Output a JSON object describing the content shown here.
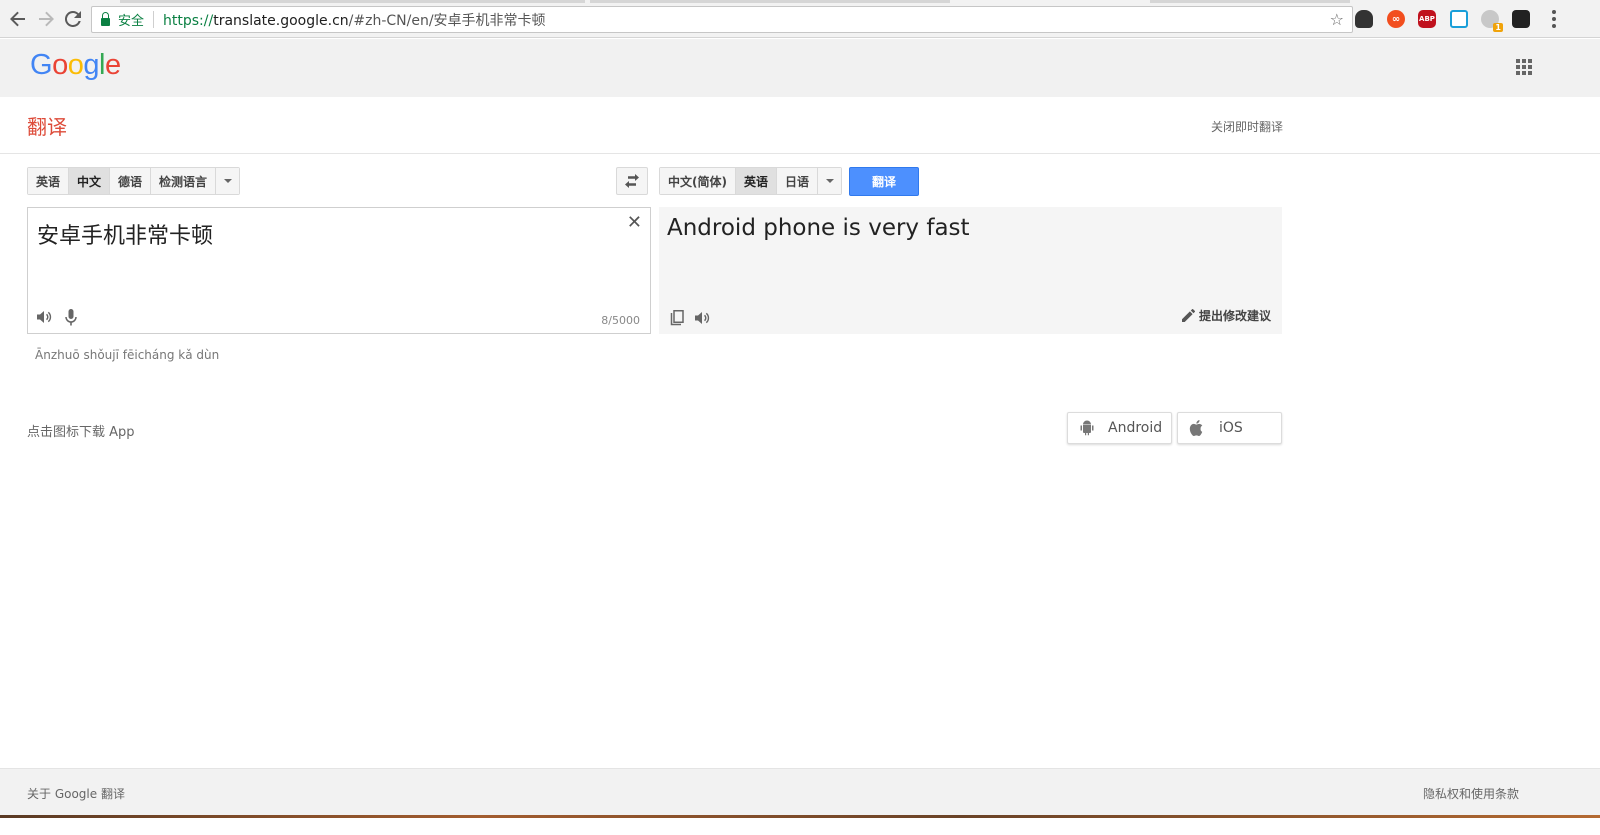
{
  "browser": {
    "secure_label": "安全",
    "url_scheme": "https://",
    "url_host": "translate.google.cn",
    "url_path": "/#zh-CN/en/安卓手机非常卡顿",
    "extensions": [
      {
        "label": ""
      },
      {
        "label": "∞"
      },
      {
        "label": "ABP"
      },
      {
        "label": ""
      },
      {
        "label": "",
        "badge": "1"
      },
      {
        "label": ""
      }
    ],
    "abp_label": "ABP",
    "inf_label": "∞",
    "badge_count": "1"
  },
  "header": {
    "logo": {
      "G": "G",
      "o1": "o",
      "o2": "o",
      "g": "g",
      "l": "l",
      "e": "e"
    }
  },
  "title_bar": {
    "title": "翻译",
    "instant_toggle": "关闭即时翻译"
  },
  "source_langs": {
    "items": [
      "英语",
      "中文",
      "德语",
      "检测语言"
    ],
    "selected": "中文"
  },
  "target_langs": {
    "items": [
      "中文(简体)",
      "英语",
      "日语"
    ],
    "selected": "英语"
  },
  "translate_button": "翻译",
  "source": {
    "text": "安卓手机非常卡顿",
    "char_count": "8/5000",
    "romanization": "Ānzhuō shǒujī fēicháng kǎ dùn"
  },
  "result": {
    "text": "Android phone is very fast",
    "suggest_label": "提出修改建议"
  },
  "app_download": {
    "text": "点击图标下载 App",
    "android_label": "Android",
    "ios_label": "iOS"
  },
  "footer": {
    "about": "关于 Google 翻译",
    "privacy": "隐私权和使用条款"
  },
  "colors": {
    "accent_red": "#dd4b39",
    "button_blue": "#4d90fe",
    "secure_green": "#0b8043"
  }
}
